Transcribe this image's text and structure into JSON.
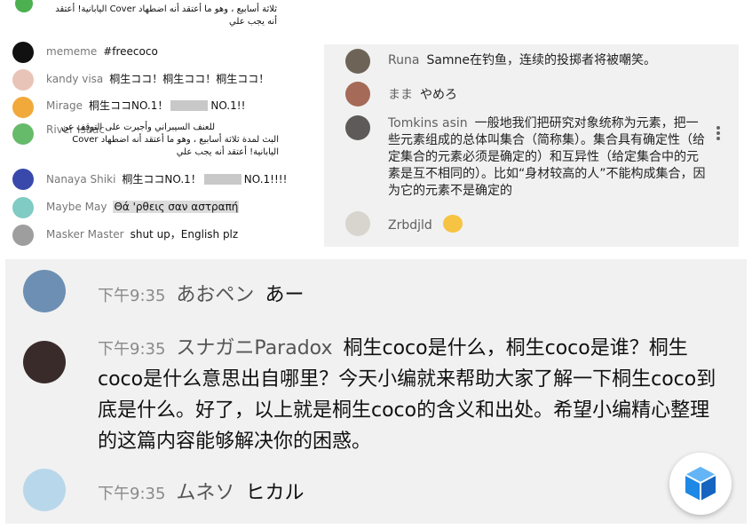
{
  "panel1": {
    "comments": [
      {
        "name": "",
        "text": "ثلاثة أسابيع ، وهو ما أعتقد أنه اضطهاد Cover اليابانية! أعتقد أنه يجب علي"
      },
      {
        "name": "mememe",
        "text": "#freecoco"
      },
      {
        "name": "kandy visa",
        "text": "桐生ココ！桐生ココ！桐生ココ！"
      },
      {
        "name": "Mirage",
        "text_a": "桐生ココNO.1！",
        "text_b": "NO.1!!"
      },
      {
        "name": "River Isaac",
        "text": "للعنف السيبراني وأجبرت على التوقف عن البث لمدة ثلاثة أسابيع ، وهو ما أعتقد أنه اضطهاد Cover اليابانية! أعتقد أنه يجب علي"
      },
      {
        "name": "Nanaya Shiki",
        "text_a": "桐生ココNO.1！",
        "text_b": "NO.1!!!!"
      },
      {
        "name": "Maybe May",
        "text": "Θά 'ρθεις σαν αστραπή"
      },
      {
        "name": "Masker Master",
        "text": "shut up，English plz"
      }
    ]
  },
  "panel2": {
    "comments": [
      {
        "name": "Runa",
        "text": "Samne在钓鱼，连续的投掷者将被嘲笑。"
      },
      {
        "name": "まま",
        "text": "やめろ"
      },
      {
        "name": "Tomkins asin",
        "text": "一般地我们把研究对象统称为元素，把一些元素组成的总体叫集合（简称集）。集合具有确定性（给定集合的元素必须是确定的）和互异性（给定集合中的元素是互不相同的）。比如“身材较高的人”不能构成集合，因为它的元素不是确定的"
      },
      {
        "name": "Zrbdjld",
        "text": ""
      }
    ],
    "more_icon": "vertical-dots-icon"
  },
  "panel3": {
    "comments": [
      {
        "time": "下午9:35",
        "name": "あおペン",
        "text": "あー"
      },
      {
        "time": "下午9:35",
        "name": "スナガニParadox",
        "text": "桐生coco是什么，桐生coco是谁？桐生coco是什么意思出自哪里？今天小编就来帮助大家了解一下桐生coco到底是什么。好了，以上就是桐生coco的含义和出处。希望小编精心整理的这篇内容能够解决你的困惑。"
      },
      {
        "time": "下午9:35",
        "name": "ムネソ",
        "text": "ヒカル"
      }
    ],
    "fab_icon": "cube-icon"
  },
  "colors": {
    "accent": "#1e88e5",
    "name_gray": "#777777",
    "panel_bg": "#f1f1f1"
  }
}
